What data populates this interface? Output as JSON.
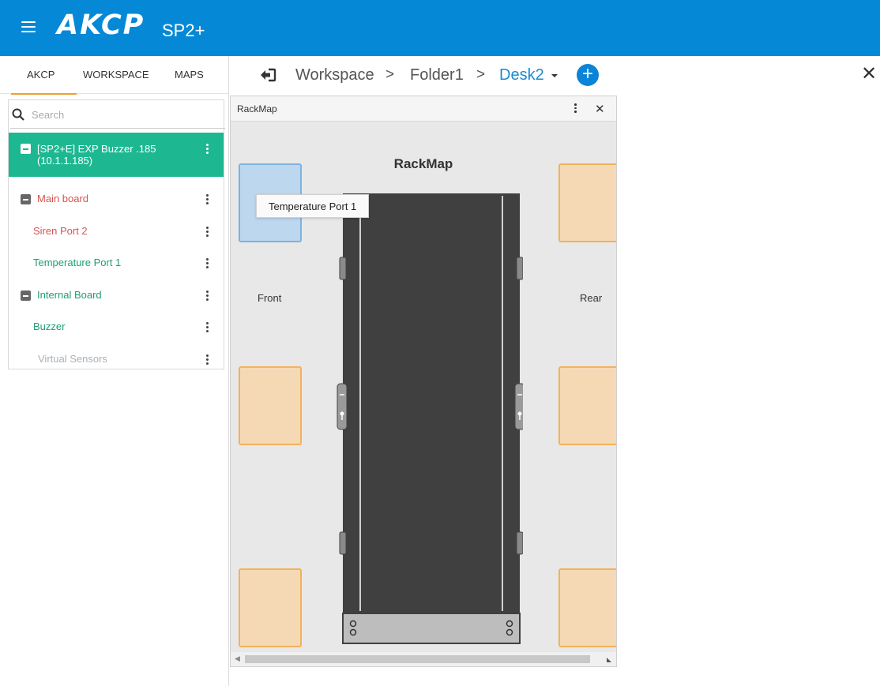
{
  "header": {
    "brand": "AKCP",
    "product": "SP2+"
  },
  "left_tabs": [
    {
      "label": "AKCP",
      "active": true
    },
    {
      "label": "WORKSPACE",
      "active": false
    },
    {
      "label": "MAPS",
      "active": false
    }
  ],
  "search": {
    "placeholder": "Search"
  },
  "tree": {
    "root": {
      "label": "[SP2+E] EXP Buzzer .185 (10.1.1.185)"
    },
    "items": [
      {
        "label": "Main board",
        "color": "#d9534f",
        "group": true
      },
      {
        "label": "Siren Port 2",
        "color": "#d9534f",
        "group": false
      },
      {
        "label": "Temperature Port 1",
        "color": "#1e9e76",
        "group": false
      },
      {
        "label": "Internal Board",
        "color": "#1e9e76",
        "group": true
      },
      {
        "label": "Buzzer",
        "color": "#1e9e76",
        "group": false
      },
      {
        "label": "Virtual Sensors",
        "color": "#a9b0b8",
        "group": false
      }
    ]
  },
  "breadcrumb": {
    "items": [
      "Workspace",
      "Folder1"
    ],
    "current": "Desk2",
    "separator": ">"
  },
  "widget": {
    "title": "RackMap",
    "heading": "RackMap",
    "tooltip": "Temperature Port 1",
    "front_label": "Front",
    "rear_label": "Rear"
  },
  "colors": {
    "header": "#0589d6",
    "root_row": "#1db891",
    "sensor_ok": "#f5d9b5",
    "sensor_highlight": "#bcd7ee",
    "rack": "#404040"
  }
}
